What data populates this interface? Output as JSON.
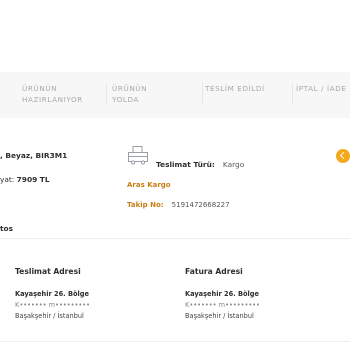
{
  "status_tabs": [
    {
      "line1": "ÜRÜNÜN",
      "line2": "HAZIRLANIYOR"
    },
    {
      "line1": "ÜRÜNÜN",
      "line2": "YOLDA"
    },
    {
      "line1": "",
      "line2": "TESLİM EDİLDİ"
    },
    {
      "line1": "",
      "line2": "İPTAL / İADE"
    }
  ],
  "order_item": {
    "product_partial": ", Beyaz, BIR3M1",
    "price_label_partial": "yat:",
    "price_value": "7909 TL",
    "status_icon_color": "#f6a81c"
  },
  "shipping": {
    "type_label": "Teslimat Türü:",
    "type_value": "Kargo",
    "carrier": "Aras Kargo",
    "tracking_label": "Takip No:",
    "tracking_value": "5191472668227"
  },
  "section_partial": "tos",
  "delivery_address": {
    "title": "Teslimat Adresi",
    "line1": "Kayaşehir 26. Bölge",
    "line2": "K••••••• m•••••••••",
    "line3": "Başakşehir / İstanbul"
  },
  "billing_address": {
    "title": "Fatura Adresi",
    "line1": "Kayaşehir 26. Bölge",
    "line2": "K••••••• m•••••••••",
    "line3": "Başakşehir / İstanbul"
  }
}
